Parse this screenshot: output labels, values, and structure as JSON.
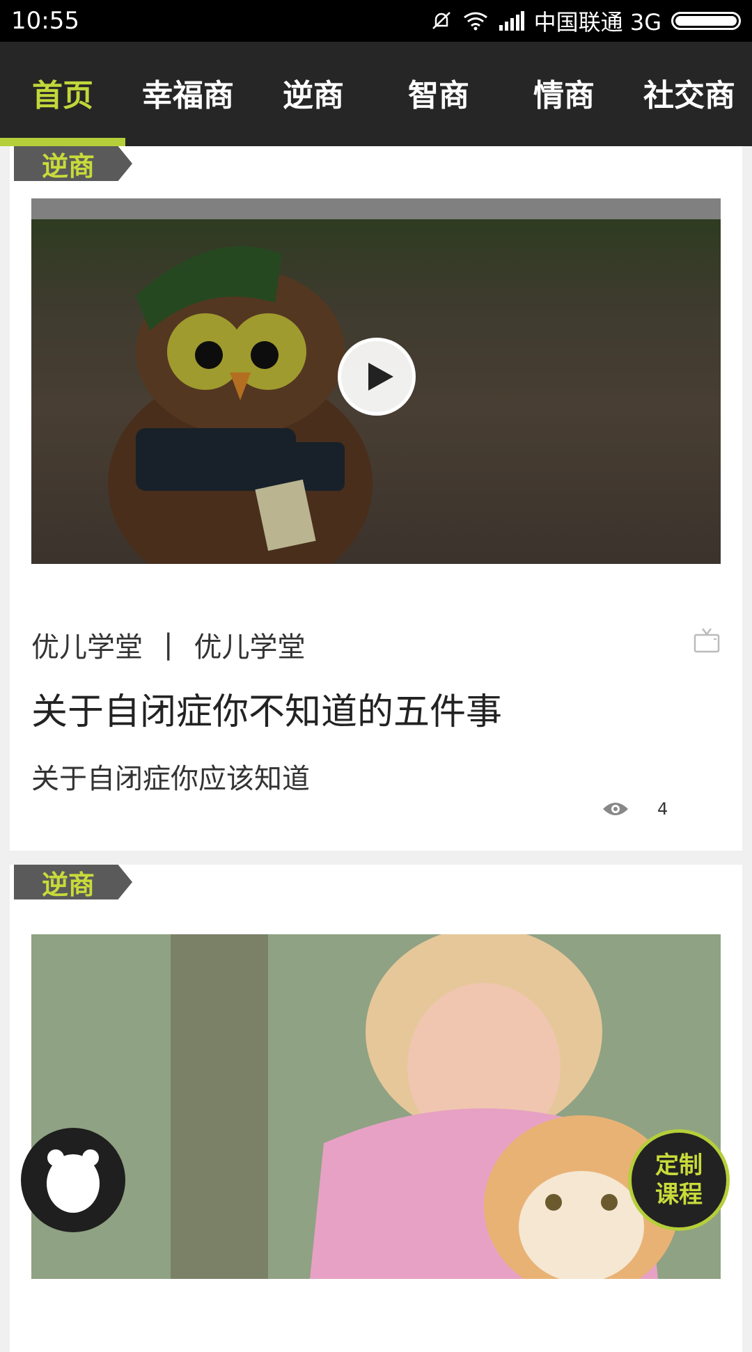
{
  "status_bar": {
    "time": "10:55",
    "carrier": "中国联通 3G",
    "icons": [
      "mute-icon",
      "wifi-icon",
      "signal-icon",
      "battery-icon"
    ]
  },
  "nav": {
    "tabs": [
      {
        "label": "首页",
        "active": true
      },
      {
        "label": "幸福商",
        "active": false
      },
      {
        "label": "逆商",
        "active": false
      },
      {
        "label": "智商",
        "active": false
      },
      {
        "label": "情商",
        "active": false
      },
      {
        "label": "社交商",
        "active": false
      }
    ],
    "accent_color": "#c2d73b"
  },
  "feed": [
    {
      "category": "逆商",
      "type": "video",
      "source_a": "优儿学堂",
      "separator": "|",
      "source_b": "优儿学堂",
      "title": "关于自闭症你不知道的五件事",
      "subtitle": "关于自闭症你应该知道",
      "views": "4"
    },
    {
      "category": "逆商",
      "type": "article"
    }
  ],
  "floating": {
    "course_button": "定制\n课程"
  }
}
